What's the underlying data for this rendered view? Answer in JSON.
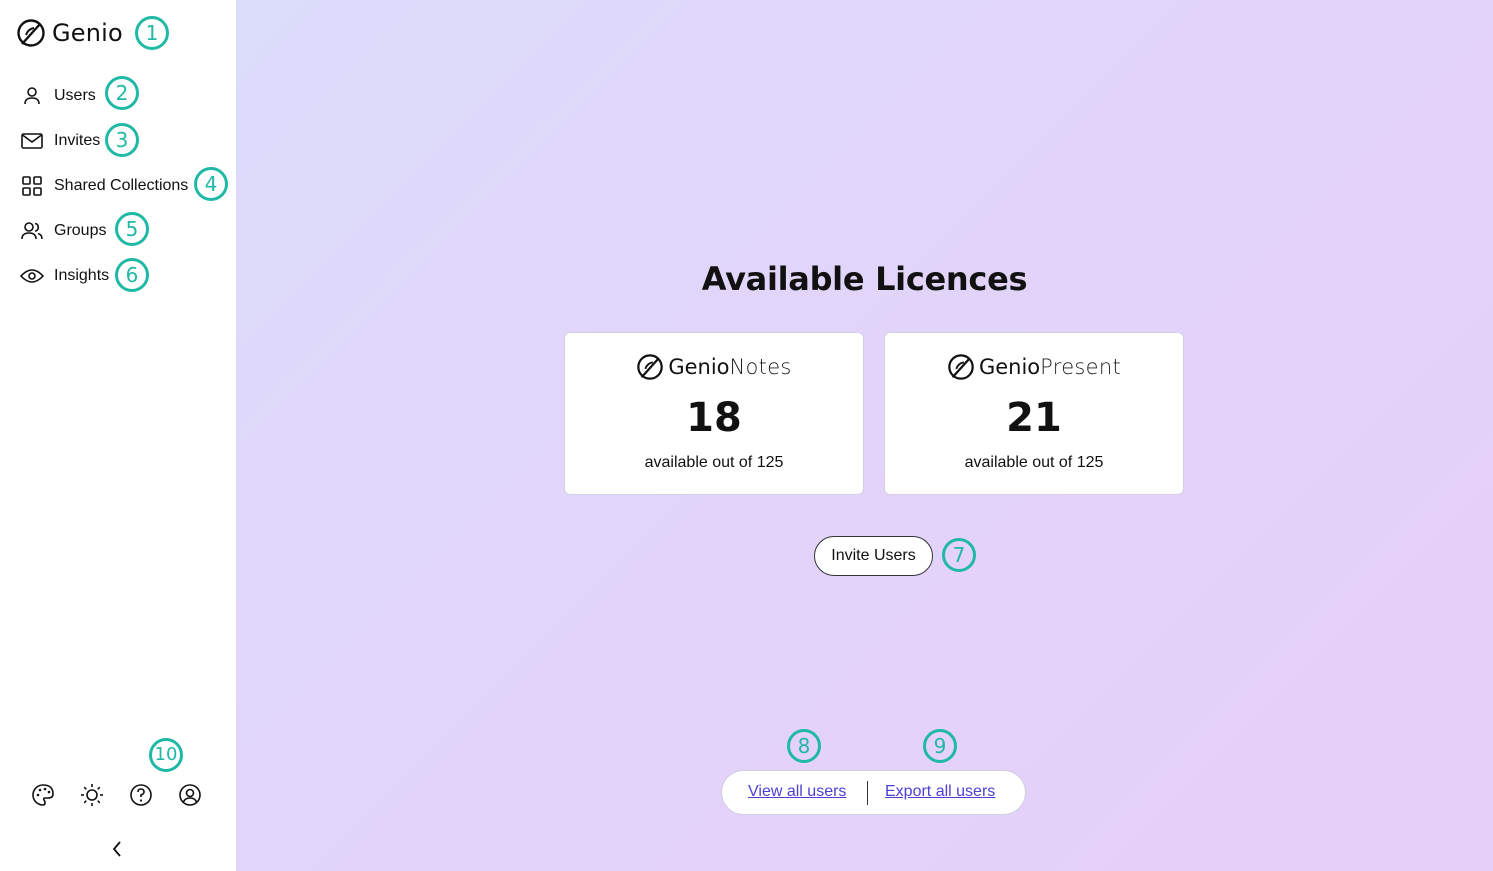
{
  "sidebar": {
    "logo_text": "Genio",
    "items": [
      {
        "label": "Users",
        "icon": "user-icon"
      },
      {
        "label": "Invites",
        "icon": "mail-icon"
      },
      {
        "label": "Shared Collections",
        "icon": "grid-icon"
      },
      {
        "label": "Groups",
        "icon": "users-icon"
      },
      {
        "label": "Insights",
        "icon": "eye-icon"
      }
    ],
    "bottom_icons": [
      "palette-icon",
      "sun-icon",
      "help-icon",
      "account-icon"
    ],
    "collapse_icon": "chevron-left-icon"
  },
  "badges": [
    "1",
    "2",
    "3",
    "4",
    "5",
    "6",
    "7",
    "8",
    "9",
    "10"
  ],
  "main": {
    "title": "Available Licences",
    "cards": [
      {
        "brand_bold": "Genio",
        "brand_light": "Notes",
        "count": "18",
        "subtitle": "available out of 125"
      },
      {
        "brand_bold": "Genio",
        "brand_light": "Present",
        "count": "21",
        "subtitle": "available out of 125"
      }
    ],
    "invite_button": "Invite Users",
    "links": {
      "view_all": "View all users",
      "export_all": "Export all users"
    }
  },
  "colors": {
    "accent_badge": "#1fb9a6",
    "link": "#4b3fd6",
    "gradient_start": "#dcdcfb",
    "gradient_end": "#e6cff9"
  }
}
